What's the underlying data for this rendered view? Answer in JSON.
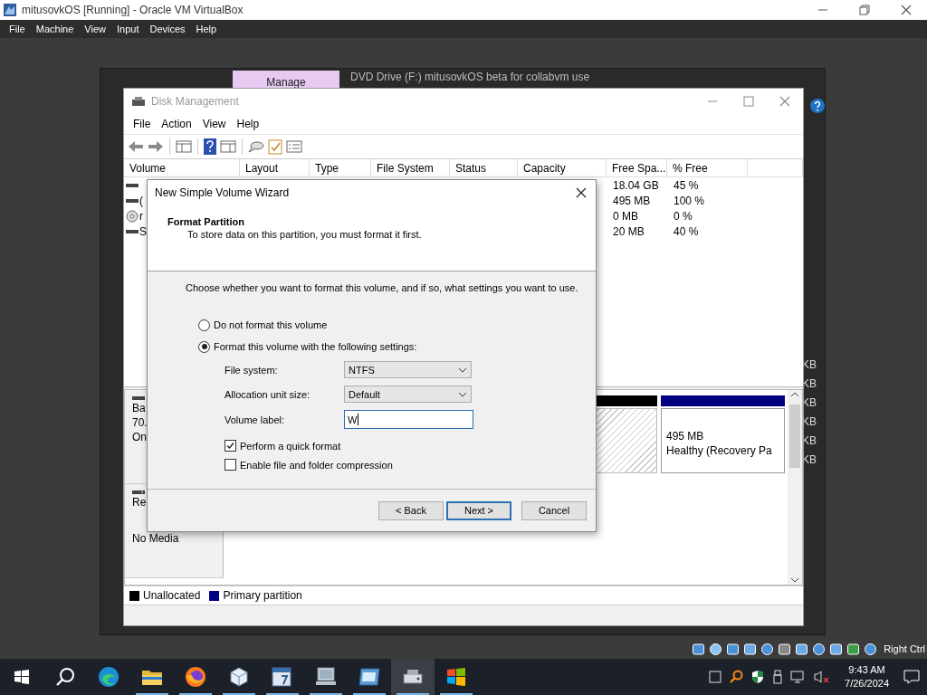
{
  "host_window": {
    "title": "mitusovkOS [Running] - Oracle VM VirtualBox",
    "menu": [
      "File",
      "Machine",
      "View",
      "Input",
      "Devices",
      "Help"
    ],
    "status_text": "Right Ctrl"
  },
  "background_window": {
    "ribbon_tab": "Manage",
    "title": "DVD Drive (F:) mitusovkOS beta for collabvm use",
    "side_texts": [
      "KB",
      "KB",
      "KB",
      "KB",
      "KB",
      "KB"
    ]
  },
  "disk_management": {
    "title": "Disk Management",
    "menu": [
      "File",
      "Action",
      "View",
      "Help"
    ],
    "columns": [
      "Volume",
      "Layout",
      "Type",
      "File System",
      "Status",
      "Capacity",
      "Free Spa...",
      "% Free"
    ],
    "rows": [
      {
        "kind": "drive",
        "free_space": "18.04 GB",
        "percent_free": "45 %"
      },
      {
        "kind": "drive",
        "volume": "(",
        "free_space": "495 MB",
        "percent_free": "100 %"
      },
      {
        "kind": "disc",
        "volume": "r",
        "free_space": "0 MB",
        "percent_free": "0 %"
      },
      {
        "kind": "drive",
        "volume": "S",
        "free_space": "20 MB",
        "percent_free": "40 %"
      }
    ],
    "disks": [
      {
        "kind": "basic",
        "lines": [
          "Ba",
          "70.",
          "On"
        ]
      },
      {
        "kind": "cdrom",
        "lines": [
          "Re"
        ],
        "media": "No Media"
      }
    ],
    "partitions": [
      {
        "kind": "unallocated",
        "color": "#000000"
      },
      {
        "kind": "primary",
        "color": "#000080",
        "size": "495 MB",
        "status": "Healthy (Recovery Pa"
      }
    ],
    "legend": [
      {
        "label": "Unallocated",
        "color": "#000000"
      },
      {
        "label": "Primary partition",
        "color": "#000080"
      }
    ]
  },
  "wizard": {
    "title": "New Simple Volume Wizard",
    "heading": "Format Partition",
    "subheading": "To store data on this partition, you must format it first.",
    "instruction": "Choose whether you want to format this volume, and if so, what settings you want to use.",
    "options": [
      {
        "label": "Do not format this volume",
        "selected": false
      },
      {
        "label": "Format this volume with the following settings:",
        "selected": true
      }
    ],
    "fields": [
      {
        "kind": "dropdown",
        "label": "File system:",
        "value": "NTFS"
      },
      {
        "kind": "dropdown",
        "label": "Allocation unit size:",
        "value": "Default"
      },
      {
        "kind": "text",
        "label": "Volume label:",
        "value": "W"
      }
    ],
    "checkboxes": [
      {
        "label": "Perform a quick format",
        "checked": true
      },
      {
        "label": "Enable file and folder compression",
        "checked": false
      }
    ],
    "buttons": [
      {
        "label": "< Back",
        "default": false
      },
      {
        "label": "Next >",
        "default": true
      },
      {
        "label": "Cancel",
        "default": false
      }
    ]
  },
  "taskbar": {
    "apps": [
      {
        "kind": "edge",
        "selected": false,
        "running": false
      },
      {
        "kind": "folder",
        "selected": false,
        "running": true
      },
      {
        "kind": "firefox",
        "selected": false,
        "running": true
      },
      {
        "kind": "cube",
        "selected": false,
        "running": true
      },
      {
        "kind": "calendar",
        "selected": false,
        "running": true
      },
      {
        "kind": "monitor",
        "selected": false,
        "running": true
      },
      {
        "kind": "window",
        "selected": false,
        "running": true
      },
      {
        "kind": "disk",
        "selected": true,
        "running": true
      },
      {
        "kind": "flag",
        "selected": false,
        "running": true
      }
    ],
    "time": "9:43 AM",
    "date": "7/26/2024"
  }
}
